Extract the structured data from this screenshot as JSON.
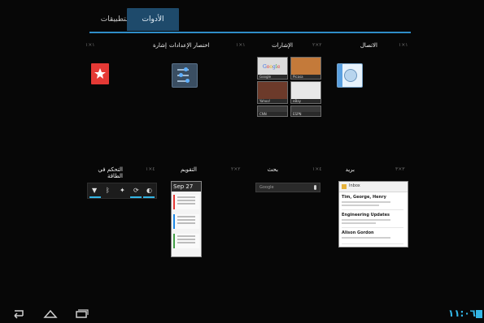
{
  "tabs": {
    "apps_label": "التطبيقات",
    "widgets_label": "الأدوات"
  },
  "widgets_row1": [
    {
      "title": "إشارة",
      "dims": "١×١"
    },
    {
      "title": "اختصار الإعدادات",
      "dims": "١×١"
    },
    {
      "title": "الإشارات",
      "dims": "٢×٢"
    },
    {
      "title": "الاتصال",
      "dims": "١×١"
    }
  ],
  "widgets_row2": [
    {
      "title": "التحكم في الطاقة",
      "dims": "٤×١"
    },
    {
      "title": "التقويم",
      "dims": "٢×٢"
    },
    {
      "title": "بحث",
      "dims": "٤×١"
    },
    {
      "title": "بريد",
      "dims": "٣×٣"
    }
  ],
  "bookmark_thumbs": [
    {
      "label": "Google"
    },
    {
      "label": "Picasa"
    },
    {
      "label": "Yahoo!"
    },
    {
      "label": "eBay"
    },
    {
      "label": "CNN"
    },
    {
      "label": "ESPN"
    }
  ],
  "calendar": {
    "date": "Sep 27",
    "events": [
      {
        "color": "#e53935"
      },
      {
        "color": "#1e88e5"
      },
      {
        "color": "#43a047"
      }
    ]
  },
  "search": {
    "placeholder": "Google"
  },
  "mail": {
    "header": "Inbox",
    "items": [
      {
        "sender": "Tim, George, Henry"
      },
      {
        "sender": "Engineering Updates"
      },
      {
        "sender": "Alison Gordon"
      }
    ]
  },
  "status": {
    "time": "١١:٠٦"
  },
  "colors": {
    "accent": "#33b5e5",
    "tab_selected": "#1e4a6b"
  }
}
